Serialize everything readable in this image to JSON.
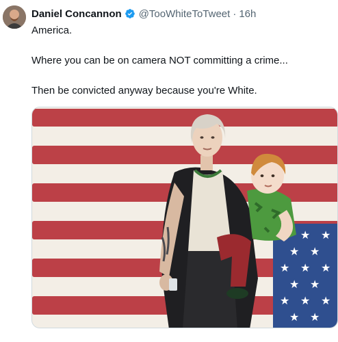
{
  "tweet": {
    "display_name": "Daniel Concannon",
    "handle": "@TooWhiteToTweet",
    "separator": "·",
    "timestamp": "16h",
    "lines": [
      "America.",
      "Where you can be on camera NOT committing a crime...",
      "Then be convicted anyway because you're White."
    ]
  },
  "icons": {
    "verified": "verified-badge-icon",
    "avatar": "profile-avatar"
  },
  "colors": {
    "verified_blue": "#1d9bf0",
    "flag_red": "#b8323a",
    "flag_blue": "#2f4f8f",
    "text_primary": "#0f1419",
    "text_secondary": "#536471"
  }
}
